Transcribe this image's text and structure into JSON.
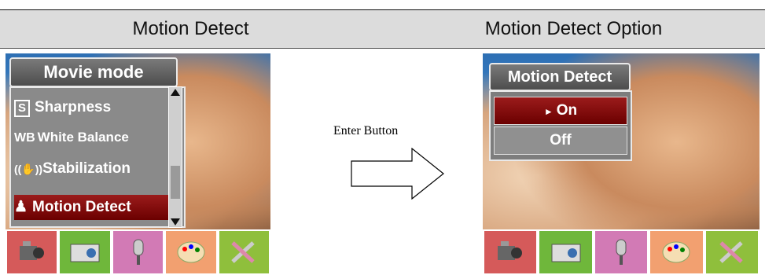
{
  "header": {
    "left_title": "Motion Detect",
    "right_title": "Motion Detect Option"
  },
  "left_screen": {
    "menu_title": "Movie mode",
    "items": [
      {
        "icon": "S",
        "label": "Sharpness"
      },
      {
        "icon": "WB",
        "label": "White Balance"
      },
      {
        "icon": "stabilization-hand-icon",
        "label": "Stabilization"
      },
      {
        "icon": "motion-figure-icon",
        "label": "Motion Detect",
        "selected": true
      }
    ]
  },
  "arrow": {
    "label": "Enter Button"
  },
  "right_screen": {
    "menu_title": "Motion Detect",
    "options": [
      {
        "label": "On",
        "marker": "►",
        "selected": true
      },
      {
        "label": "Off",
        "selected": false
      }
    ]
  },
  "bottom_icons": [
    {
      "name": "movie-camera-icon",
      "color": "#d55a5a"
    },
    {
      "name": "camera-icon",
      "color": "#6fb73b"
    },
    {
      "name": "microphone-icon",
      "color": "#d27ab5"
    },
    {
      "name": "palette-icon",
      "color": "#f2a070"
    },
    {
      "name": "tools-icon",
      "color": "#8fbf3c"
    }
  ]
}
